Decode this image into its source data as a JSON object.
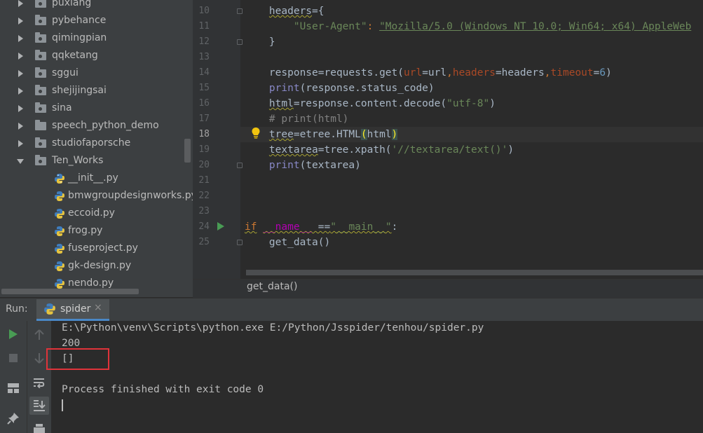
{
  "project_tree": {
    "folders": [
      {
        "label": "puxiang",
        "type": "package"
      },
      {
        "label": "pybehance",
        "type": "package"
      },
      {
        "label": "qimingpian",
        "type": "package"
      },
      {
        "label": "qqketang",
        "type": "package"
      },
      {
        "label": "sggui",
        "type": "package"
      },
      {
        "label": "shejijingsai",
        "type": "package"
      },
      {
        "label": "sina",
        "type": "package"
      },
      {
        "label": "speech_python_demo",
        "type": "folder"
      },
      {
        "label": "studiofaporsche",
        "type": "package"
      },
      {
        "label": "Ten_Works",
        "type": "package",
        "expanded": true
      }
    ],
    "files": [
      "__init__.py",
      "bmwgroupdesignworks.py",
      "eccoid.py",
      "frog.py",
      "fuseproject.py",
      "gk-design.py",
      "nendo.py"
    ]
  },
  "editor": {
    "line_numbers": [
      "10",
      "11",
      "12",
      "13",
      "14",
      "15",
      "16",
      "17",
      "18",
      "19",
      "20",
      "21",
      "22",
      "23",
      "24",
      "25"
    ],
    "current_line": "18",
    "code": {
      "l10_var": "headers",
      "l10_rest": "={",
      "l11_key": "\"User-Agent\"",
      "l11_colon": ": ",
      "l11_val": "\"Mozilla/5.0 (Windows NT 10.0; Win64; x64) AppleWeb",
      "l12": "}",
      "l14_a": "response",
      "l14_b": "=requests.get(",
      "l14_p1": "url",
      "l14_c": "=url",
      "l14_p2": "headers",
      "l14_d": "=headers",
      "l14_p3": "timeout",
      "l14_e": "=",
      "l14_num": "6",
      "l14_f": ")",
      "l15_fn": "print",
      "l15_rest": "(response.status_code)",
      "l16_a": "html",
      "l16_b": "=response.content.decode(",
      "l16_str": "\"utf-8\"",
      "l16_c": ")",
      "l17": "# print(html)",
      "l18_a": "tree",
      "l18_b": "=etree.HTML",
      "l18_open": "(",
      "l18_c": "html",
      "l18_close": ")",
      "l19_a": "textarea",
      "l19_b": "=tree.xpath(",
      "l19_str": "'//textarea/text()'",
      "l19_c": ")",
      "l20_fn": "print",
      "l20_rest": "(textarea)",
      "l24_kw": "if",
      "l24_magic": "__name__",
      "l24_eq": " ==",
      "l24_str": "\"__main__\"",
      "l24_colon": ":",
      "l25": "get_data()"
    },
    "breadcrumb": "get_data()"
  },
  "run_panel": {
    "label": "Run:",
    "tab_label": "spider",
    "tab_close": "×",
    "console_lines": [
      "E:\\Python\\venv\\Scripts\\python.exe E:/Python/Jsspider/tenhou/spider.py",
      "200",
      "[]",
      "",
      "Process finished with exit code 0"
    ]
  },
  "colors": {
    "accent": "#4a88c7",
    "run_green": "#499c54",
    "highlight_red": "#e0333a"
  }
}
